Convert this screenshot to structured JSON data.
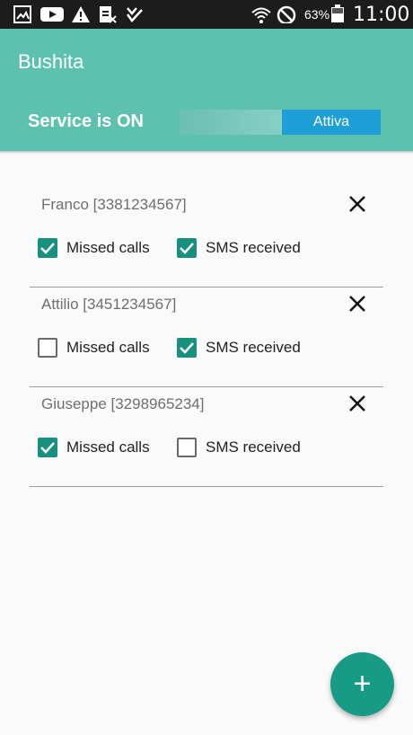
{
  "status_bar": {
    "battery": "63%",
    "time": "11:00"
  },
  "app": {
    "title": "Bushita",
    "service_status": "Service is ON",
    "toggle_label": "Attiva"
  },
  "contacts": [
    {
      "name": "Franco [3381234567]",
      "missed_calls": {
        "label": "Missed calls",
        "checked": true
      },
      "sms_received": {
        "label": "SMS received",
        "checked": true
      }
    },
    {
      "name": "Attilio [3451234567]",
      "missed_calls": {
        "label": "Missed calls",
        "checked": false
      },
      "sms_received": {
        "label": "SMS received",
        "checked": true
      }
    },
    {
      "name": "Giuseppe [3298965234]",
      "missed_calls": {
        "label": "Missed calls",
        "checked": true
      },
      "sms_received": {
        "label": "SMS received",
        "checked": false
      }
    }
  ],
  "fab": {
    "label": "+"
  },
  "colors": {
    "app_bar": "#5cc2ae",
    "toggle_on": "#1e9fd8",
    "checkbox": "#17907f",
    "fab": "#179a86"
  }
}
